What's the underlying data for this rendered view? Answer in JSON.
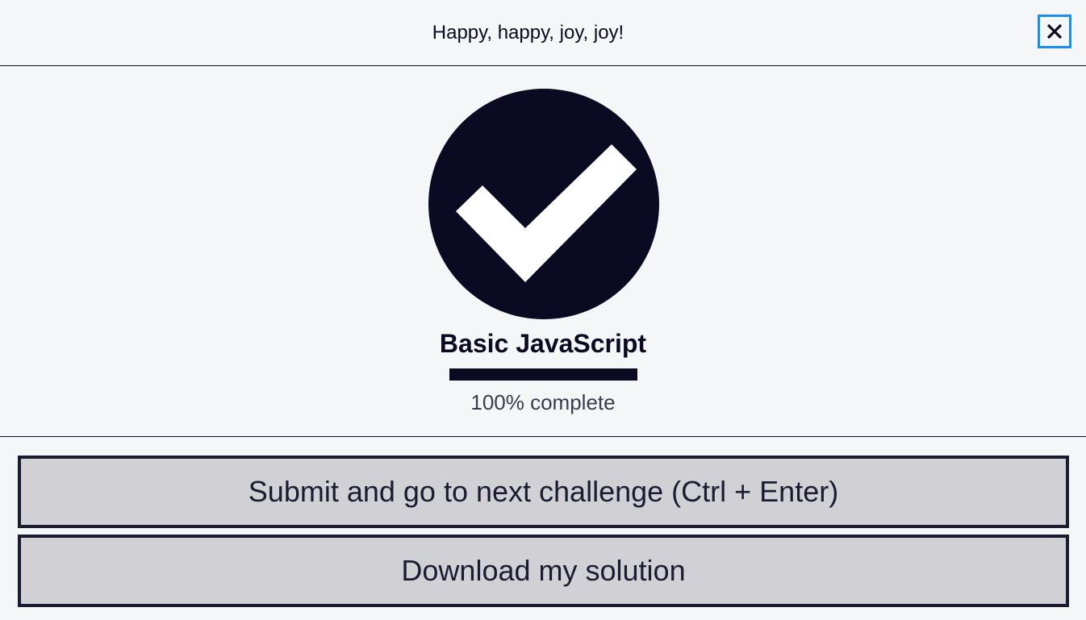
{
  "header": {
    "title": "Happy, happy, joy, joy!",
    "close_icon": "close-icon"
  },
  "completion": {
    "icon": "checkmark-circle-icon",
    "block_title": "Basic JavaScript",
    "progress_percent": 100,
    "progress_label": "100% complete"
  },
  "actions": {
    "submit_label": "Submit and go to next challenge (Ctrl + Enter)",
    "download_label": "Download my solution"
  },
  "colors": {
    "background": "#f5f6f7",
    "primary_dark": "#0a0a23",
    "button_bg": "#d0d0d5",
    "focus_ring": "#198eee"
  }
}
